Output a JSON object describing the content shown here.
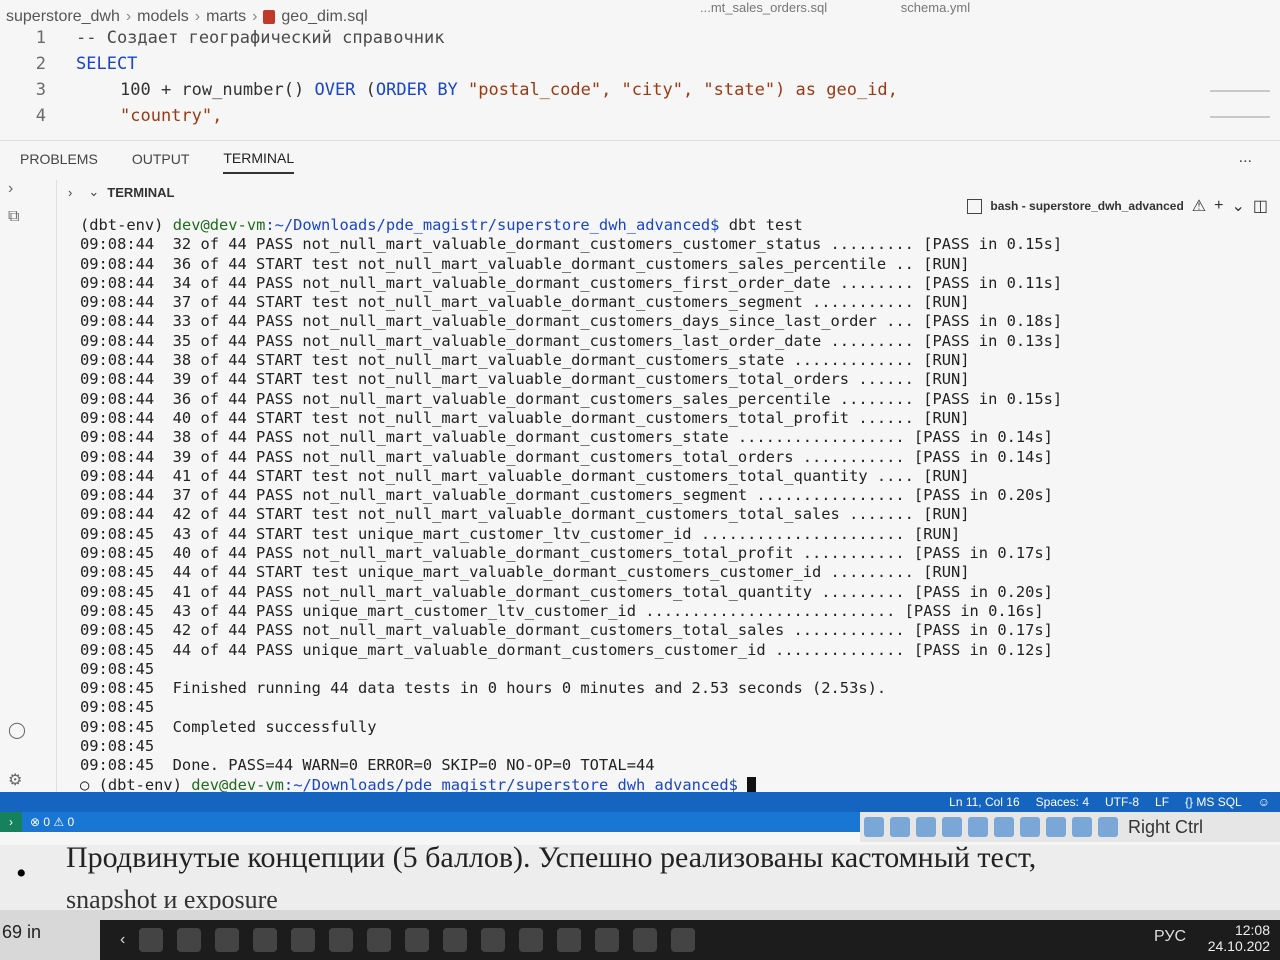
{
  "breadcrumb": {
    "root": "superstore_dwh",
    "models": "models",
    "marts": "marts",
    "file": "geo_dim.sql"
  },
  "ghost_tabs": [
    "...mt_sales_orders.sql",
    "schema.yml"
  ],
  "editor": {
    "lines": [
      {
        "n": "1",
        "comment": "-- Создает географический справочник"
      },
      {
        "n": "2",
        "kw": "SELECT"
      },
      {
        "n": "3",
        "a": "100 + row_number() ",
        "kw1": "OVER",
        "b": " (",
        "kw2": "ORDER BY",
        "c": " \"postal_code\", \"city\", \"state\") as geo_id,"
      },
      {
        "n": "4",
        "text": "\"country\","
      }
    ]
  },
  "panel": {
    "tabs": [
      "PROBLEMS",
      "OUTPUT",
      "TERMINAL"
    ],
    "active": "TERMINAL",
    "more": "...",
    "section": "TERMINAL",
    "instance": "bash - superstore_dwh_advanced",
    "add": "+"
  },
  "terminal": {
    "prompt_env": "(dbt-env)",
    "prompt_user": "dev@dev-vm",
    "prompt_path": ":~/Downloads/pde_magistr/superstore_dwh_advanced$",
    "command": "dbt test",
    "rows": [
      "09:08:44  32 of 44 PASS not_null_mart_valuable_dormant_customers_customer_status ......... [PASS in 0.15s]",
      "09:08:44  36 of 44 START test not_null_mart_valuable_dormant_customers_sales_percentile .. [RUN]",
      "09:08:44  34 of 44 PASS not_null_mart_valuable_dormant_customers_first_order_date ........ [PASS in 0.11s]",
      "09:08:44  37 of 44 START test not_null_mart_valuable_dormant_customers_segment ........... [RUN]",
      "09:08:44  33 of 44 PASS not_null_mart_valuable_dormant_customers_days_since_last_order ... [PASS in 0.18s]",
      "09:08:44  35 of 44 PASS not_null_mart_valuable_dormant_customers_last_order_date ......... [PASS in 0.13s]",
      "09:08:44  38 of 44 START test not_null_mart_valuable_dormant_customers_state ............. [RUN]",
      "09:08:44  39 of 44 START test not_null_mart_valuable_dormant_customers_total_orders ...... [RUN]",
      "09:08:44  36 of 44 PASS not_null_mart_valuable_dormant_customers_sales_percentile ........ [PASS in 0.15s]",
      "09:08:44  40 of 44 START test not_null_mart_valuable_dormant_customers_total_profit ...... [RUN]",
      "09:08:44  38 of 44 PASS not_null_mart_valuable_dormant_customers_state .................. [PASS in 0.14s]",
      "09:08:44  39 of 44 PASS not_null_mart_valuable_dormant_customers_total_orders ........... [PASS in 0.14s]",
      "09:08:44  41 of 44 START test not_null_mart_valuable_dormant_customers_total_quantity .... [RUN]",
      "09:08:44  37 of 44 PASS not_null_mart_valuable_dormant_customers_segment ................ [PASS in 0.20s]",
      "09:08:44  42 of 44 START test not_null_mart_valuable_dormant_customers_total_sales ....... [RUN]",
      "09:08:45  43 of 44 START test unique_mart_customer_ltv_customer_id ...................... [RUN]",
      "09:08:45  40 of 44 PASS not_null_mart_valuable_dormant_customers_total_profit ........... [PASS in 0.17s]",
      "09:08:45  44 of 44 START test unique_mart_valuable_dormant_customers_customer_id ......... [RUN]",
      "09:08:45  41 of 44 PASS not_null_mart_valuable_dormant_customers_total_quantity ......... [PASS in 0.20s]",
      "09:08:45  43 of 44 PASS unique_mart_customer_ltv_customer_id ........................... [PASS in 0.16s]",
      "09:08:45  42 of 44 PASS not_null_mart_valuable_dormant_customers_total_sales ............ [PASS in 0.17s]",
      "09:08:45  44 of 44 PASS unique_mart_valuable_dormant_customers_customer_id .............. [PASS in 0.12s]",
      "09:08:45",
      "09:08:45  Finished running 44 data tests in 0 hours 0 minutes and 2.53 seconds (2.53s).",
      "09:08:45",
      "09:08:45  Completed successfully",
      "09:08:45",
      "09:08:45  Done. PASS=44 WARN=0 ERROR=0 SKIP=0 NO-OP=0 TOTAL=44"
    ]
  },
  "statusbar": {
    "position": "Ln 11, Col 16",
    "spaces": "Spaces: 4",
    "encoding": "UTF-8",
    "eol": "LF",
    "language": "{} MS SQL",
    "problems": "⊗ 0 ⚠ 0"
  },
  "vm": {
    "host_key": "Right Ctrl"
  },
  "document": {
    "bullet": "•",
    "line1": "Продвинутые концепции (5 баллов). Успешно реализованы кастомный тест,",
    "line2": "snapshot и exposure"
  },
  "word_status": {
    "zoom": "69 in"
  },
  "tray": {
    "lang": "РУС",
    "time": "12:08",
    "date": "24.10.202"
  },
  "colors": {
    "statusbar": "#1565c0",
    "keyword": "#1a45c6",
    "prompt_user": "#1f6b1f"
  }
}
